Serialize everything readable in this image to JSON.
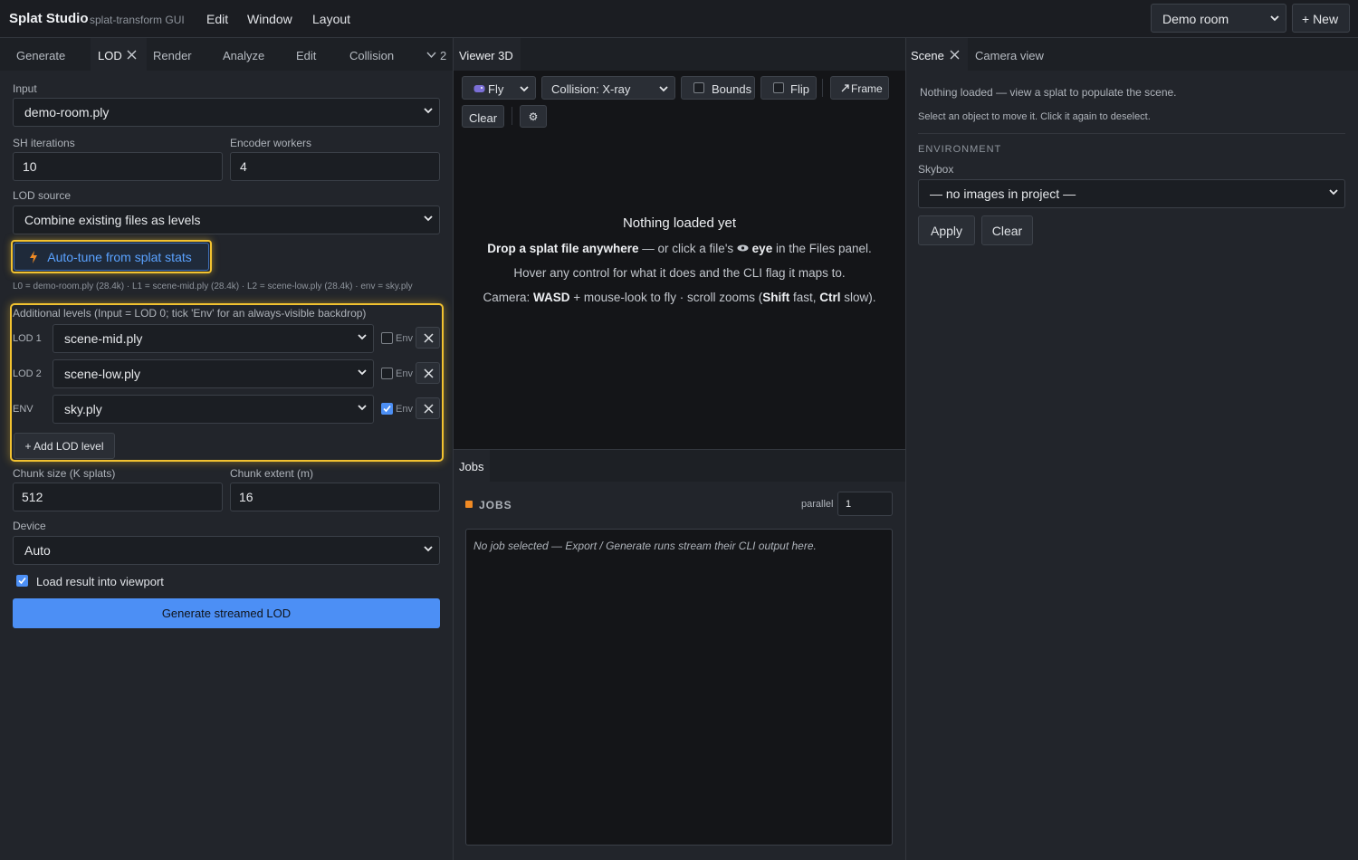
{
  "app": {
    "title": "Splat Studio",
    "subtitle": "splat-transform GUI"
  },
  "menu": [
    "Edit",
    "Window",
    "Layout"
  ],
  "project": {
    "selected": "Demo room",
    "new_label": "+ New"
  },
  "left_tabs": {
    "items": [
      "Generate",
      "LOD",
      "Render",
      "Analyze",
      "Edit",
      "Collision"
    ],
    "overflow": "2",
    "active": "LOD"
  },
  "lod": {
    "input_label": "Input",
    "input_value": "demo-room.ply",
    "sh_label": "SH iterations",
    "sh_value": "10",
    "workers_label": "Encoder workers",
    "workers_value": "4",
    "source_label": "LOD source",
    "source_value": "Combine existing files as levels",
    "autotune_label": "Auto-tune from splat stats",
    "summary": "L0 = demo-room.ply (28.4k) · L1 = scene-mid.ply (28.4k) · L2 = scene-low.ply (28.4k) · env = sky.ply",
    "levels_title": "Additional levels (Input = LOD 0; tick 'Env' for an always-visible backdrop)",
    "env_label": "Env",
    "levels": [
      {
        "tag": "LOD 1",
        "file": "scene-mid.ply",
        "env": false
      },
      {
        "tag": "LOD 2",
        "file": "scene-low.ply",
        "env": false
      },
      {
        "tag": "ENV",
        "file": "sky.ply",
        "env": true
      }
    ],
    "add_level_label": "+ Add LOD level",
    "chunk_size_label": "Chunk size (K splats)",
    "chunk_size_value": "512",
    "chunk_extent_label": "Chunk extent (m)",
    "chunk_extent_value": "16",
    "device_label": "Device",
    "device_value": "Auto",
    "load_label": "Load result into viewport",
    "load_checked": true,
    "generate_label": "Generate streamed LOD"
  },
  "viewer": {
    "tab": "Viewer 3D",
    "mode": "Fly",
    "collision": "Collision: X-ray",
    "bounds_label": "Bounds",
    "flip_label": "Flip",
    "frame_label": "Frame",
    "clear_label": "Clear",
    "settings_glyph": "⚙",
    "empty_title": "Nothing loaded yet",
    "line1": {
      "b1": "Drop a splat file anywhere",
      "t1": " — or click a file's ",
      "b2": "eye",
      "t2": " in the Files panel."
    },
    "line2": "Hover any control for what it does and the CLI flag it maps to.",
    "line3": {
      "t1": "Camera: ",
      "b1": "WASD",
      "t2": " + mouse-look to fly · scroll zooms (",
      "b2": "Shift",
      "t3": " fast, ",
      "b3": "Ctrl",
      "t4": " slow)."
    }
  },
  "jobs": {
    "tab": "Jobs",
    "title": "JOBS",
    "parallel_label": "parallel",
    "parallel_value": "1",
    "empty": "No job selected — Export / Generate runs stream their CLI output here."
  },
  "scene": {
    "tabs": [
      "Scene",
      "Camera view"
    ],
    "nothing": "Nothing loaded — view a splat to populate the scene.",
    "hint": "Select an object to move it. Click it again to deselect.",
    "env_header": "ENVIRONMENT",
    "skybox_label": "Skybox",
    "skybox_value": "— no images in project —",
    "apply_label": "Apply",
    "clear_label": "Clear"
  },
  "colors": {
    "accent": "#4c8ff5",
    "highlight": "#f2c230",
    "jobs_dot": "#f08a24",
    "bg": "#22252b"
  }
}
